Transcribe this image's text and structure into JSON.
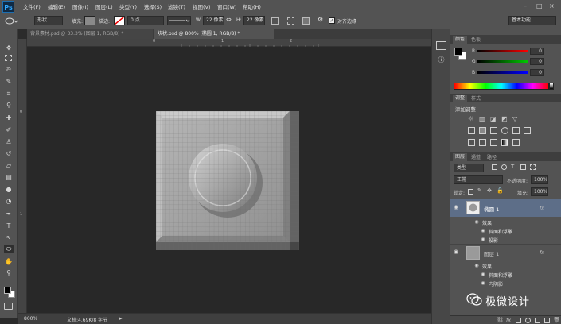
{
  "app": {
    "logo": "Ps"
  },
  "menu": [
    "文件(F)",
    "编辑(E)",
    "图像(I)",
    "图层(L)",
    "类型(Y)",
    "选择(S)",
    "滤镜(T)",
    "视图(V)",
    "窗口(W)",
    "帮助(H)"
  ],
  "window_controls": [
    "–",
    "□",
    "×"
  ],
  "options": {
    "mode": "形状",
    "fill_label": "填充:",
    "stroke_label": "描边:",
    "stroke_width": "0 点",
    "w_label": "W:",
    "w_value": "22 像素",
    "h_label": "H:",
    "h_value": "22 像素",
    "align_edges": "对齐边缘",
    "workspace": "基本功能"
  },
  "tabs": [
    {
      "label": "背景素材.psd @ 33.3% (图层 1, RGB/8) *",
      "active": false
    },
    {
      "label": "块状.psd @ 800% (椭圆 1, RGB/8) *",
      "active": true
    }
  ],
  "rulers": {
    "top": [
      "0",
      "1",
      "2"
    ],
    "left": [
      "0",
      "1"
    ]
  },
  "status": {
    "zoom": "800%",
    "doc": "文档:4.69K/8 字节"
  },
  "color_panel": {
    "tabs": [
      "颜色",
      "色板"
    ],
    "channels": [
      {
        "label": "R",
        "value": "0",
        "color": "#ff0000"
      },
      {
        "label": "G",
        "value": "0",
        "color": "#00c800"
      },
      {
        "label": "B",
        "value": "0",
        "color": "#0000ff"
      }
    ]
  },
  "adjust_panel": {
    "tabs": [
      "调整",
      "样式"
    ],
    "title": "添加调整"
  },
  "layers_panel": {
    "tabs": [
      "图层",
      "通道",
      "路径"
    ],
    "kind": "类型",
    "blend_mode": "正常",
    "opacity_label": "不透明度:",
    "opacity": "100%",
    "lock_label": "锁定:",
    "fill_label": "填充:",
    "fill": "100%",
    "layers": [
      {
        "name": "椭圆 1",
        "fx": "fx",
        "selected": true,
        "effects_label": "效果",
        "effects": [
          "斜面和浮雕",
          "投影"
        ]
      },
      {
        "name": "图层 1",
        "fx": "fx",
        "selected": false,
        "effects_label": "效果",
        "effects": [
          "斜面和浮雕",
          "内阴影"
        ]
      }
    ]
  },
  "watermark": {
    "text": "极微设计"
  }
}
